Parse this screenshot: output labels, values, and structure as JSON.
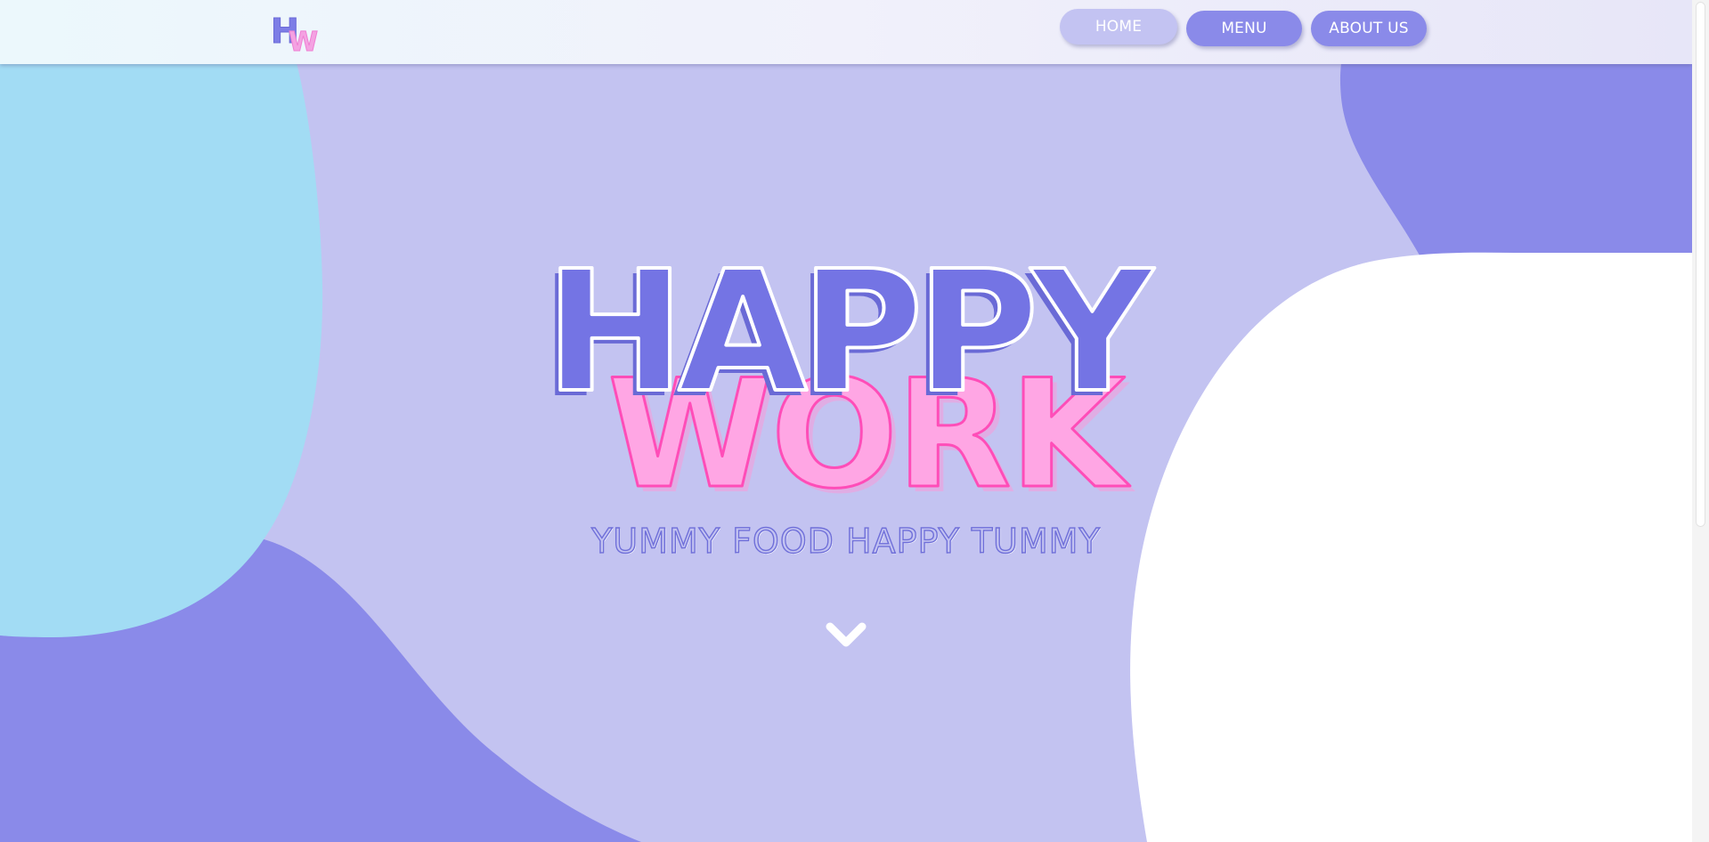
{
  "logo": {
    "letters": [
      "H",
      "W"
    ],
    "colors": [
      "#7d7de6",
      "#f4a2e2"
    ]
  },
  "nav": {
    "items": [
      {
        "label": "HOME",
        "active": true
      },
      {
        "label": "MENU",
        "active": false
      },
      {
        "label": "ABOUT US",
        "active": false
      }
    ]
  },
  "hero": {
    "title_top": "HAPPY",
    "title_bottom": "WORK",
    "tagline": "YUMMY FOOD HAPPY TUMMY",
    "scroll_icon": "chevron-down-icon"
  },
  "colors": {
    "background": "#c3c3f1",
    "blob_light_blue": "#a2dcf4",
    "blob_periwinkle": "#8a8ae9",
    "blob_white": "#ffffff",
    "title_fill": "#7474e4",
    "title_shadow": "#8b8bea",
    "title_bottom_fill": "#ffa6e4",
    "title_bottom_outline": "#ff4db8",
    "accent": "#8a8ae9"
  }
}
